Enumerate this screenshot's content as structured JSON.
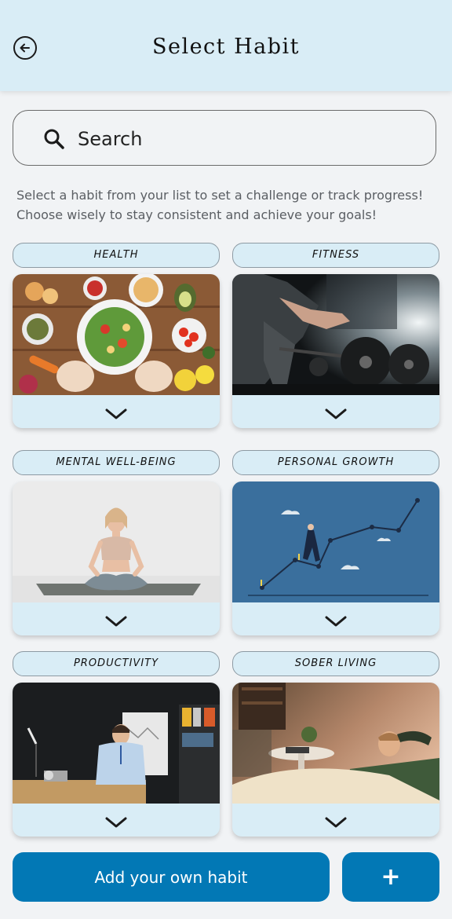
{
  "header": {
    "title": "Select Habit",
    "back_icon": "arrow-left-circle-icon"
  },
  "search": {
    "placeholder": "Search",
    "icon": "search-icon"
  },
  "description": {
    "line1": "Select a habit from your list to set a challenge or track progress!",
    "line2": "Choose wisely to stay consistent and achieve your goals!"
  },
  "habits": [
    {
      "label": "HEALTH"
    },
    {
      "label": "FITNESS"
    },
    {
      "label": "MENTAL WELL-BEING"
    },
    {
      "label": "PERSONAL GROWTH"
    },
    {
      "label": "PRODUCTIVITY"
    },
    {
      "label": "SOBER LIVING"
    }
  ],
  "footer": {
    "add_label": "Add your own habit",
    "plus_label": "+"
  },
  "colors": {
    "header_bg": "#d9edf6",
    "primary": "#0278b5",
    "page_bg": "#f1f3f5"
  }
}
